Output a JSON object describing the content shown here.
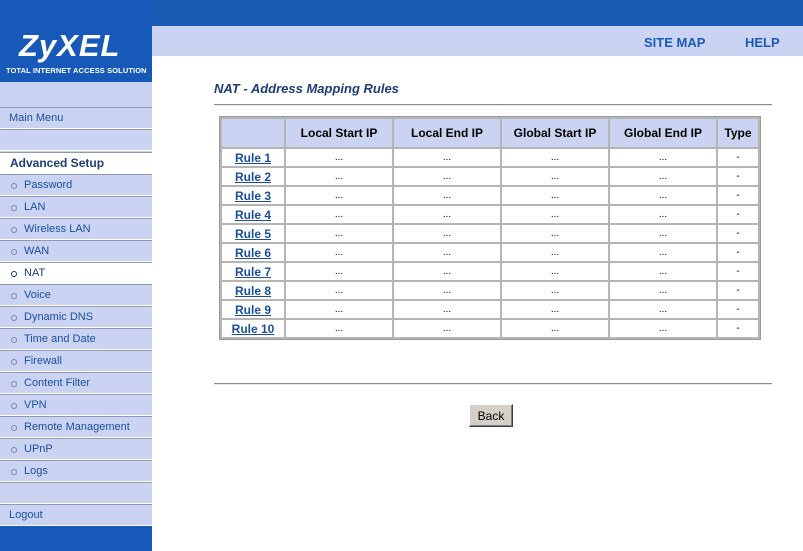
{
  "brand": {
    "logo": "ZyXEL",
    "tagline": "TOTAL INTERNET ACCESS SOLUTION"
  },
  "header": {
    "site_map": "SITE MAP",
    "help": "HELP"
  },
  "sidebar": {
    "main_menu": "Main Menu",
    "section_title": "Advanced Setup",
    "items": [
      {
        "label": "Password",
        "active": false
      },
      {
        "label": "LAN",
        "active": false
      },
      {
        "label": "Wireless LAN",
        "active": false
      },
      {
        "label": "WAN",
        "active": false
      },
      {
        "label": "NAT",
        "active": true
      },
      {
        "label": "Voice",
        "active": false
      },
      {
        "label": "Dynamic DNS",
        "active": false
      },
      {
        "label": "Time and Date",
        "active": false
      },
      {
        "label": "Firewall",
        "active": false
      },
      {
        "label": "Content Filter",
        "active": false
      },
      {
        "label": "VPN",
        "active": false
      },
      {
        "label": "Remote Management",
        "active": false
      },
      {
        "label": "UPnP",
        "active": false
      },
      {
        "label": "Logs",
        "active": false
      }
    ],
    "logout": "Logout"
  },
  "main": {
    "title": "NAT - Address Mapping Rules",
    "columns": [
      "",
      "Local Start IP",
      "Local End IP",
      "Global Start IP",
      "Global End IP",
      "Type"
    ],
    "rows": [
      {
        "rule": "Rule 1",
        "local_start": "...",
        "local_end": "...",
        "global_start": "...",
        "global_end": "...",
        "type": "-"
      },
      {
        "rule": "Rule 2",
        "local_start": "...",
        "local_end": "...",
        "global_start": "...",
        "global_end": "...",
        "type": "-"
      },
      {
        "rule": "Rule 3",
        "local_start": "...",
        "local_end": "...",
        "global_start": "...",
        "global_end": "...",
        "type": "-"
      },
      {
        "rule": "Rule 4",
        "local_start": "...",
        "local_end": "...",
        "global_start": "...",
        "global_end": "...",
        "type": "-"
      },
      {
        "rule": "Rule 5",
        "local_start": "...",
        "local_end": "...",
        "global_start": "...",
        "global_end": "...",
        "type": "-"
      },
      {
        "rule": "Rule 6",
        "local_start": "...",
        "local_end": "...",
        "global_start": "...",
        "global_end": "...",
        "type": "-"
      },
      {
        "rule": "Rule 7",
        "local_start": "...",
        "local_end": "...",
        "global_start": "...",
        "global_end": "...",
        "type": "-"
      },
      {
        "rule": "Rule 8",
        "local_start": "...",
        "local_end": "...",
        "global_start": "...",
        "global_end": "...",
        "type": "-"
      },
      {
        "rule": "Rule 9",
        "local_start": "...",
        "local_end": "...",
        "global_start": "...",
        "global_end": "...",
        "type": "-"
      },
      {
        "rule": "Rule 10",
        "local_start": "...",
        "local_end": "...",
        "global_start": "...",
        "global_end": "...",
        "type": "-"
      }
    ],
    "back_label": "Back"
  },
  "colors": {
    "brand_blue": "#1659b8",
    "panel_lavender": "#cad4f2",
    "link_blue": "#1a4e9c"
  }
}
